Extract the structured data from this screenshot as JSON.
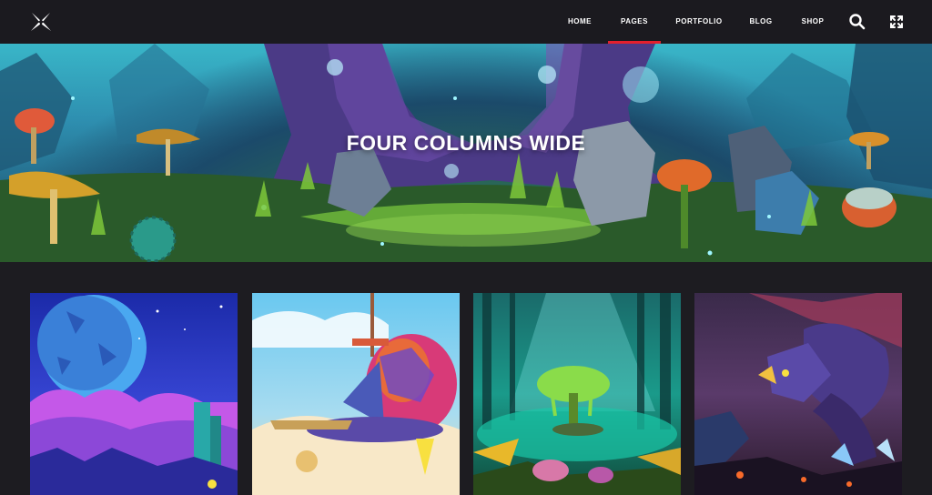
{
  "header": {
    "logo_icon": "x-star-logo-icon",
    "nav": [
      {
        "label": "HOME",
        "active": false
      },
      {
        "label": "PAGES",
        "active": true
      },
      {
        "label": "PORTFOLIO",
        "active": false
      },
      {
        "label": "BLOG",
        "active": false
      },
      {
        "label": "SHOP",
        "active": false
      }
    ],
    "icons": [
      "search-icon",
      "fullscreen-icon"
    ]
  },
  "hero": {
    "title": "FOUR COLUMNS WIDE"
  },
  "gallery": [
    {
      "name": "moonlit-fantasy-landscape"
    },
    {
      "name": "flying-airship-sky"
    },
    {
      "name": "enchanted-swamp-tree"
    },
    {
      "name": "purple-dragon"
    }
  ],
  "colors": {
    "background": "#1d1c21",
    "header": "#1b1a1f",
    "accent": "#e3202c",
    "text": "#ffffff"
  }
}
